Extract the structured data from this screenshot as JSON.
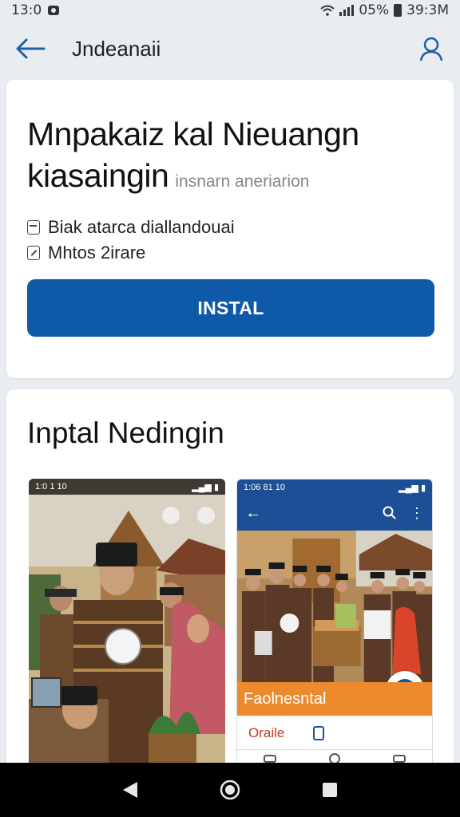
{
  "status": {
    "time": "13:0",
    "battery_text": "05%",
    "clock_right": "39:3M"
  },
  "appbar": {
    "title": "Jndeanaii",
    "back_icon": "arrow-left-icon",
    "profile_icon": "user-icon"
  },
  "app": {
    "title": "Mnpakaiz kal Nieuangn kiasaingin",
    "subtitle": "insnarn aneriarion",
    "meta": [
      {
        "icon": "calendar-icon",
        "text": "Biak atarca diallandouai"
      },
      {
        "icon": "edit-icon",
        "text": "Mhtos 2irare"
      }
    ],
    "install_label": "INSTAL",
    "install_color": "#0e5aa8"
  },
  "screenshots_section": {
    "title": "Inptal Nedingin",
    "shot1": {
      "status_left": "1:0 1 10"
    },
    "shot2": {
      "status_left": "1:06 81 10",
      "banner": "Faolnesntal",
      "tool_label": "Oraile"
    }
  },
  "navbar": {
    "back_icon": "triangle-back-icon",
    "home_icon": "circle-home-icon",
    "recents_icon": "square-recents-icon"
  }
}
